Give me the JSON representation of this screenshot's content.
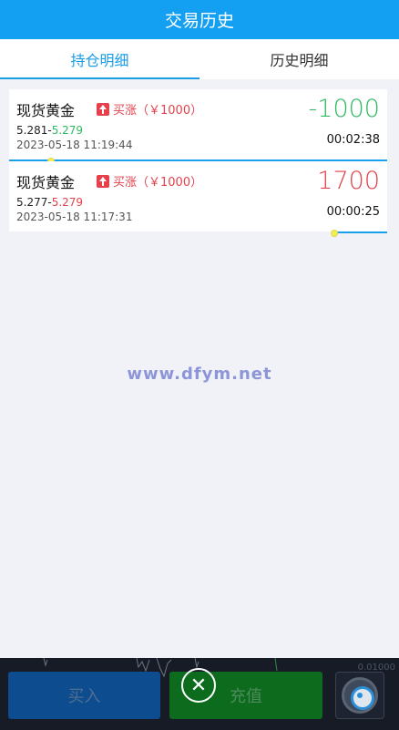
{
  "header": {
    "title": "交易历史"
  },
  "tabs": [
    {
      "label": "持仓明细",
      "active": true
    },
    {
      "label": "历史明细",
      "active": false
    }
  ],
  "orders": [
    {
      "name": "现货黄金",
      "direction": "买涨（￥1000）",
      "open_price": "5.281",
      "sep": "-",
      "current_price": "5.279",
      "current_color": "green",
      "timestamp": "2023-05-18 11:19:44",
      "pl": "-1000",
      "pl_color": "green",
      "duration": "00:02:38",
      "progress_percent": 100,
      "marker_percent": 11
    },
    {
      "name": "现货黄金",
      "direction": "买涨（￥1000）",
      "open_price": "5.277",
      "sep": "-",
      "current_price": "5.279",
      "current_color": "red",
      "timestamp": "2023-05-18 11:17:31",
      "pl": "1700",
      "pl_color": "red",
      "duration": "00:00:25",
      "progress_percent": 14,
      "marker_percent": 86
    }
  ],
  "watermark": "www.dfym.net",
  "bottom": {
    "axis_value": "0.01000",
    "buy_label": "买入",
    "recharge_label": "充值",
    "close_glyph": "✕"
  },
  "colors": {
    "header": "#13a0f2",
    "green": "#2fb960",
    "red": "#e2424d",
    "accent": "#1a9de6"
  },
  "icons": [
    "arrow-up-icon",
    "close-icon",
    "customer-service-icon"
  ]
}
